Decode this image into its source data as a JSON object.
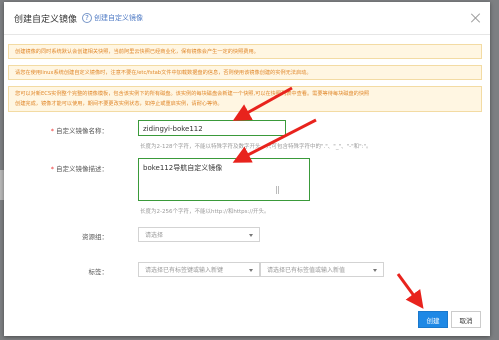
{
  "dialog": {
    "title": "创建自定义镜像",
    "help_link": "创建自定义镜像",
    "close_icon": "close-icon"
  },
  "notices": {
    "n1": "创建镜像的同时系统默认会创建相关快照，当前阿里云快照已经商业化，保有镜像会产生一定的快照费用。",
    "n2": "请您在使用linux系统创建自定义镜像时，注意不要在/etc/fstab文件中加载数据盘的信息，否则使用该镜像创建的实例无法启动。",
    "n3_line1": "您可以对新ECS实例整个完整的镜像模板，包含该实例下的所有磁盘。该实例的每块磁盘会新建一个快照,可以在快照列表中查看。需要等待每块磁盘的快照",
    "n3_line2": "创建完成，镜像才能可以使用，期间不要更改实例状态，如停止或重启实例，请耐心等待。"
  },
  "form": {
    "name_label": "自定义镜像名称：",
    "name_value": "zidingyi-boke112",
    "name_hint": "长度为2-128个字符，不能以特殊字符及数字开头，只可包含特殊字符中的\".\"、\"_\"、\"-\"和\":\"。",
    "desc_label": "自定义镜像描述：",
    "desc_value": "boke112导航自定义镜像",
    "desc_hint": "长度为2-256个字符，不能以http://和https://开头。",
    "resource_group_label": "资源组：",
    "resource_group_placeholder": "请选择",
    "tags_label": "标签：",
    "tag_key_placeholder": "请选择已有标签键或输入新键",
    "tag_value_placeholder": "请选择已有标签值或输入新值",
    "required_mark": "*"
  },
  "footer": {
    "create_label": "创建",
    "cancel_label": "取消"
  },
  "colors": {
    "primary": "#1e88e5",
    "warning_text": "#e0872a",
    "warning_bg": "#fff6e2",
    "focus_border": "#3a9a3a",
    "annotation_arrow": "#e8231d"
  }
}
